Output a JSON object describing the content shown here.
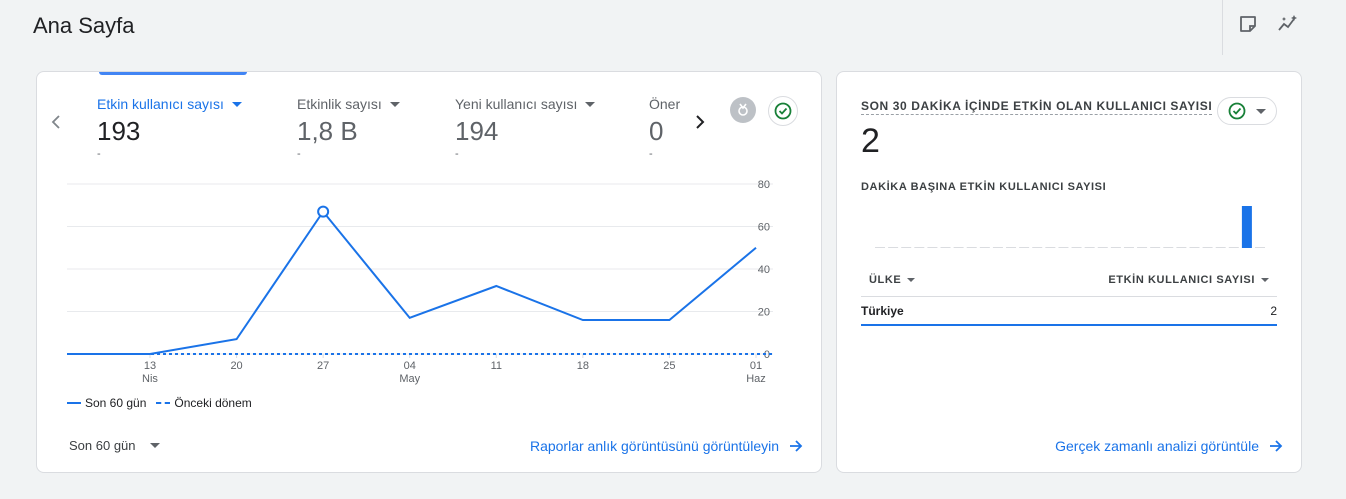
{
  "page": {
    "title": "Ana Sayfa"
  },
  "toolbar": {
    "icons": [
      "note-icon",
      "insights-icon"
    ]
  },
  "overview": {
    "metrics": [
      {
        "label": "Etkin kullanıcı sayısı",
        "value": "193",
        "change": "-"
      },
      {
        "label": "Etkinlik sayısı",
        "value": "1,8 B",
        "change": "-"
      },
      {
        "label": "Yeni kullanıcı sayısı",
        "value": "194",
        "change": "-"
      },
      {
        "label": "Öner",
        "value": "0",
        "change": "-"
      }
    ],
    "period_select": "Son 60 gün",
    "link": "Raporlar anlık görüntüsünü görüntüleyin",
    "legend": {
      "current": "Son 60 gün",
      "previous": "Önceki dönem"
    }
  },
  "chart_data": {
    "type": "line",
    "x_ticks": [
      {
        "day": "13",
        "month": "Nis"
      },
      {
        "day": "20",
        "month": ""
      },
      {
        "day": "27",
        "month": ""
      },
      {
        "day": "04",
        "month": "May"
      },
      {
        "day": "11",
        "month": ""
      },
      {
        "day": "18",
        "month": ""
      },
      {
        "day": "25",
        "month": ""
      },
      {
        "day": "01",
        "month": "Haz"
      }
    ],
    "y_ticks": [
      "80",
      "60",
      "40",
      "20",
      "0"
    ],
    "ylim": [
      0,
      80
    ],
    "grid": true,
    "series": [
      {
        "name": "Son 60 gün",
        "style": "solid",
        "points": [
          {
            "x": "07 Nis",
            "y": 0
          },
          {
            "x": "13 Nis",
            "y": 0
          },
          {
            "x": "20 Nis",
            "y": 7
          },
          {
            "x": "27 Nis",
            "y": 67
          },
          {
            "x": "04 May",
            "y": 17
          },
          {
            "x": "11 May",
            "y": 32
          },
          {
            "x": "18 May",
            "y": 16
          },
          {
            "x": "25 May",
            "y": 16
          },
          {
            "x": "01 Haz",
            "y": 50
          }
        ]
      },
      {
        "name": "Önceki dönem",
        "style": "dashed",
        "points": [
          {
            "x": "07 Nis",
            "y": 0
          },
          {
            "x": "01 Haz",
            "y": 0
          }
        ]
      }
    ],
    "highlight_point": "27 Nis",
    "legend_position": "bottom-left",
    "colors": {
      "line": "#1a73e8"
    }
  },
  "realtime": {
    "title": "SON 30 DAKİKA İÇİNDE ETKİN OLAN KULLANICI SAYISI",
    "value": "2",
    "subtitle": "DAKİKA BAŞINA ETKİN KULLANICI SAYISI",
    "minute_values": [
      0,
      0,
      0,
      0,
      0,
      0,
      0,
      0,
      0,
      0,
      0,
      0,
      0,
      0,
      0,
      0,
      0,
      0,
      0,
      0,
      0,
      0,
      0,
      0,
      0,
      0,
      0,
      0,
      1,
      0
    ],
    "table": {
      "col1": "ÜLKE",
      "col2": "ETKİN KULLANICI SAYISI",
      "rows": [
        {
          "country": "Türkiye",
          "users": "2"
        }
      ]
    },
    "link": "Gerçek zamanlı analizi görüntüle"
  }
}
